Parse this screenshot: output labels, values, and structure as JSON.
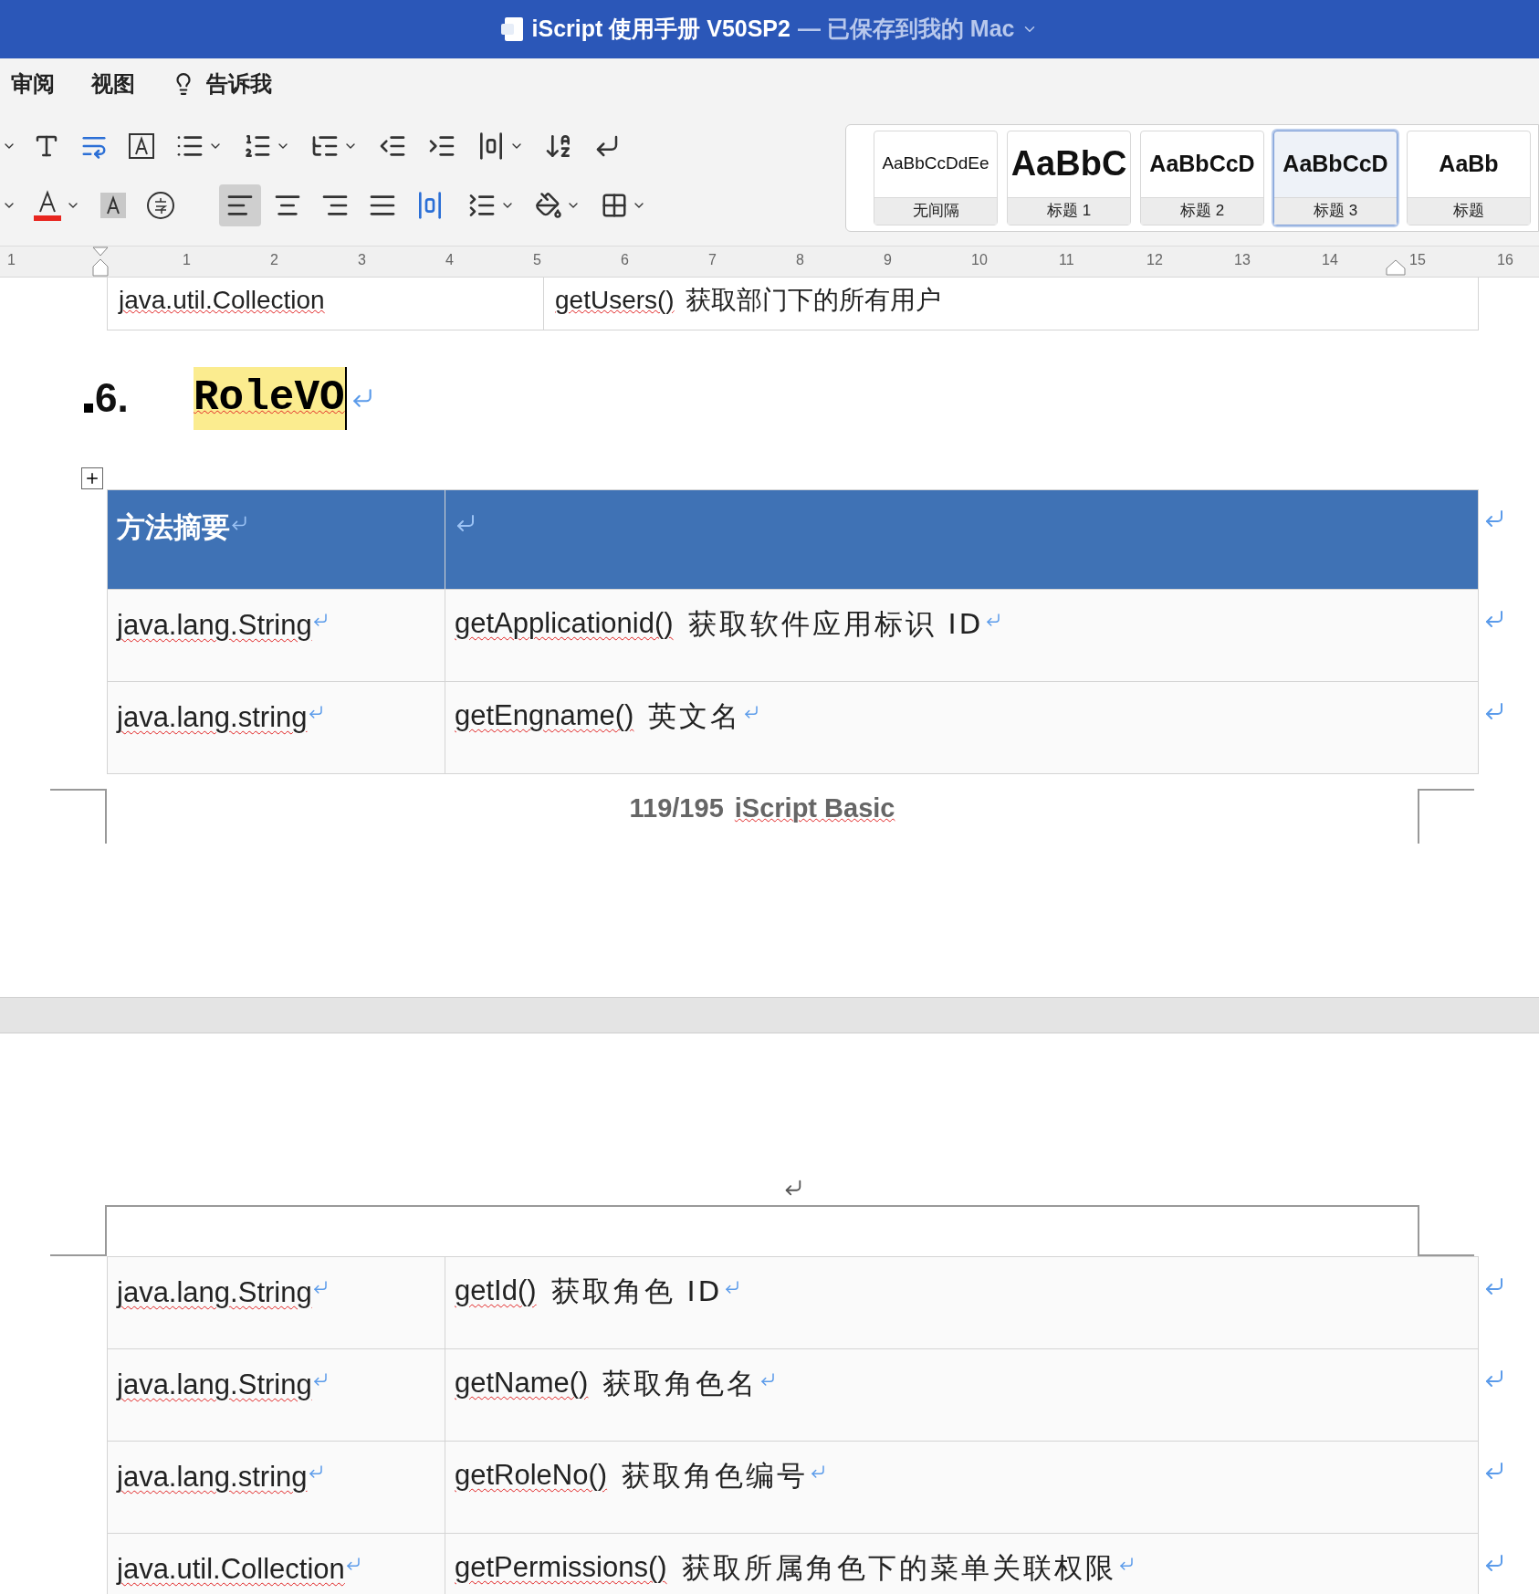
{
  "window": {
    "title": "iScript 使用手册 V50SP2",
    "status": "— 已保存到我的 Mac"
  },
  "menu": [
    {
      "label": "审阅",
      "kind": "text"
    },
    {
      "label": "视图",
      "kind": "text"
    },
    {
      "label": "告诉我",
      "kind": "tell"
    }
  ],
  "alignment": [
    {
      "selected": true
    },
    {
      "selected": false
    },
    {
      "selected": false
    },
    {
      "selected": false
    },
    {
      "selected": false
    }
  ],
  "styles": [
    {
      "preview": "AaBbCcDdEe",
      "name": "无间隔",
      "kind": "plain",
      "selected": false
    },
    {
      "preview": "AaBbC",
      "name": "标题 1",
      "kind": "h1",
      "selected": false
    },
    {
      "preview": "AaBbCcD",
      "name": "标题 2",
      "kind": "h2",
      "selected": false
    },
    {
      "preview": "AaBbCcD",
      "name": "标题 3",
      "kind": "h3",
      "selected": true
    },
    {
      "preview": "AaBb",
      "name": "标题",
      "kind": "h2",
      "selected": false
    }
  ],
  "ruler": [
    "1",
    "1",
    "2",
    "3",
    "4",
    "5",
    "6",
    "7",
    "8",
    "9",
    "10",
    "11",
    "12",
    "13",
    "14",
    "15",
    "16"
  ],
  "page1": {
    "prev_rows": [
      {
        "type": "java.util.Collection",
        "method": "getUsers()",
        "desc": "获取部门下的所有用户"
      }
    ],
    "heading": {
      "number": "6.",
      "text": "RoleVO"
    },
    "table_header": "方法摘要",
    "rows": [
      {
        "type": "java.lang.String",
        "method": "getApplicationid()",
        "desc": "获取软件应用标识 ID"
      },
      {
        "type": "java.lang.string",
        "method": "getEngname()",
        "desc": "英文名"
      }
    ],
    "footer": {
      "page": "119/195",
      "title": "iScript Basic"
    }
  },
  "page2": {
    "rows": [
      {
        "type": "java.lang.String",
        "method": "getId()",
        "desc": "获取角色 ID"
      },
      {
        "type": "java.lang.String",
        "method": "getName()",
        "desc": "获取角色名"
      },
      {
        "type": "java.lang.string",
        "method": "getRoleNo()",
        "desc": "获取角色编号"
      },
      {
        "type": "java.util.Collection",
        "method": "getPermissions()",
        "desc": "获取所属角色下的菜单关联权限"
      }
    ]
  }
}
